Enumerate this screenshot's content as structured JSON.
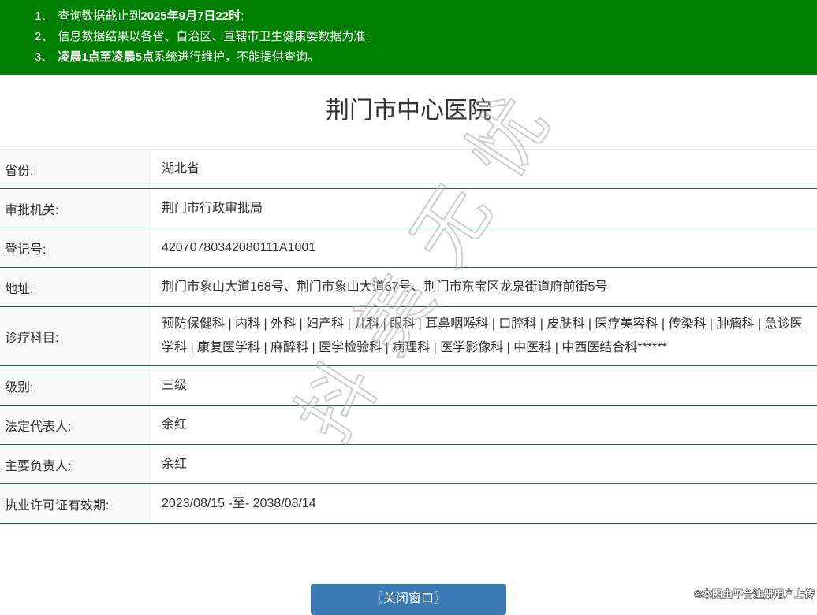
{
  "colors": {
    "banner_green": "#008000",
    "divider_green": "#156e3e",
    "label_bg": "#fafafa",
    "button_blue": "#3d79b5",
    "text": "#333333"
  },
  "notice": {
    "items": [
      {
        "number": "1、",
        "segments": [
          {
            "text": "查询数据截止到",
            "bold": false
          },
          {
            "text": "2025年9月7日22时",
            "bold": true
          },
          {
            "text": ";",
            "bold": false
          }
        ]
      },
      {
        "number": "2、",
        "segments": [
          {
            "text": "信息数据结果以各省、自治区、直辖市卫生健康委数据为准;",
            "bold": false
          }
        ]
      },
      {
        "number": "3、",
        "segments": [
          {
            "text": "凌晨1点至凌晨5点",
            "bold": true
          },
          {
            "text": "系统进行维护，不能提供查询。",
            "bold": false
          }
        ]
      }
    ]
  },
  "page": {
    "title": "荆门市中心医院"
  },
  "details": {
    "rows": [
      {
        "label": "省份:",
        "value": "湖北省",
        "tall": false
      },
      {
        "label": "审批机关:",
        "value": "荆门市行政审批局",
        "tall": false
      },
      {
        "label": "登记号:",
        "value": "42070780342080111A1001",
        "tall": false
      },
      {
        "label": "地址:",
        "value": "荆门市象山大道168号、荆门市象山大道67号、荆门市东宝区龙泉街道府前街5号",
        "tall": false
      },
      {
        "label": "诊疗科目:",
        "value": "预防保健科 | 内科 | 外科 | 妇产科 | 儿科 | 眼科 | 耳鼻咽喉科 | 口腔科 | 皮肤科 | 医疗美容科 | 传染科 | 肿瘤科 | 急诊医学科 | 康复医学科 | 麻醉科 | 医学检验科 | 病理科 | 医学影像科 | 中医科 | 中西医结合科******",
        "tall": true
      },
      {
        "label": "级别:",
        "value": "三级",
        "tall": false
      },
      {
        "label": "法定代表人:",
        "value": "余红",
        "tall": false
      },
      {
        "label": "主要负责人:",
        "value": "余红",
        "tall": false
      },
      {
        "label": "执业许可证有效期:",
        "value": "2023/08/15 -至- 2038/08/14",
        "tall": false
      }
    ]
  },
  "actions": {
    "close_button": "〖关闭窗口〗"
  },
  "watermark": {
    "text": "抖美无忧"
  },
  "footer": {
    "credit": "©本图由平台注册用户上传"
  }
}
